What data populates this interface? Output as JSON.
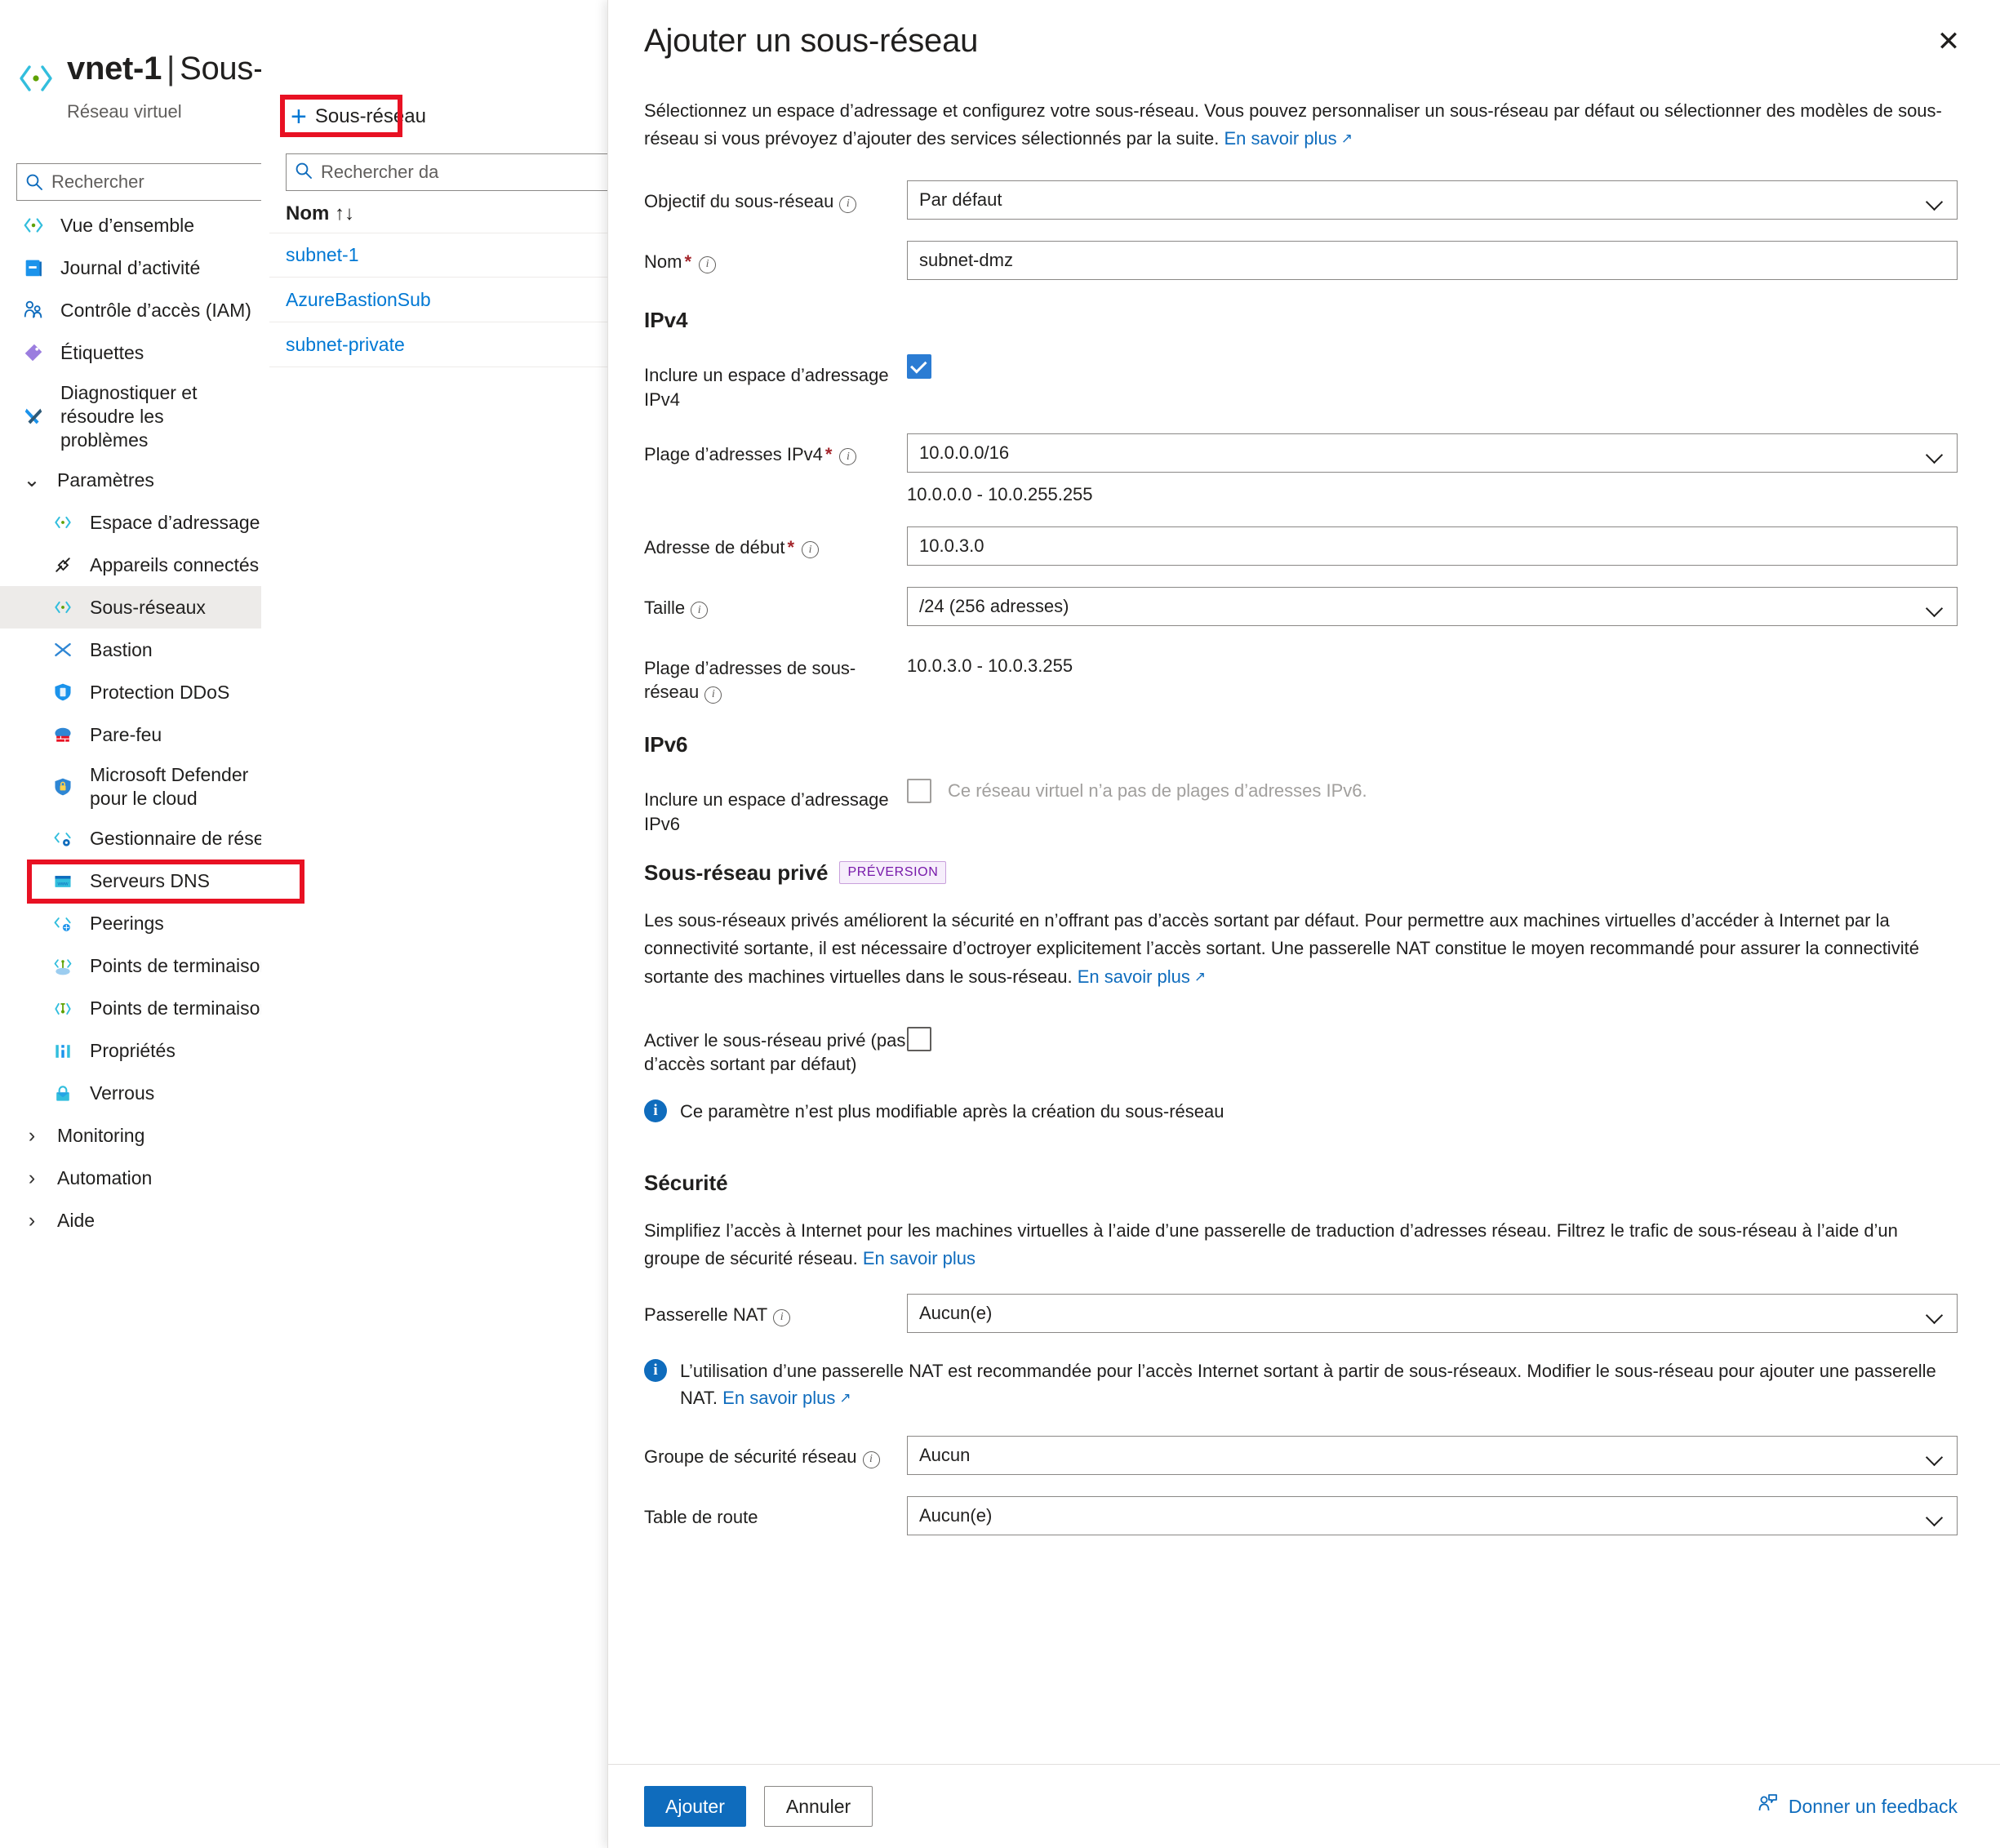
{
  "resource": {
    "icon": "virtual-network-icon",
    "name": "vnet-1",
    "separator": "|",
    "section": "Sous-réseaux",
    "type_label": "Réseau virtuel",
    "favorite_icon": "star-icon",
    "more_icon": "ellipsis-icon"
  },
  "nav": {
    "search_placeholder": "Rechercher",
    "sort_icon": "sort-icon",
    "collapse_icon": "collapse-icon",
    "items": [
      {
        "label": "Vue d’ensemble",
        "icon": "virtual-network-icon",
        "level": "top",
        "selected": false
      },
      {
        "label": "Journal d’activité",
        "icon": "activity-log-icon",
        "level": "top",
        "selected": false
      },
      {
        "label": "Contrôle d’accès (IAM)",
        "icon": "access-control-icon",
        "level": "top",
        "selected": false
      },
      {
        "label": "Étiquettes",
        "icon": "tag-icon",
        "level": "top",
        "selected": false
      },
      {
        "label": "Diagnostiquer et résoudre les problèmes",
        "icon": "troubleshoot-icon",
        "level": "top",
        "selected": false
      },
      {
        "label": "Paramètres",
        "icon": "chevron-down-icon",
        "level": "group",
        "selected": false
      },
      {
        "label": "Espace d’adressage",
        "icon": "address-space-icon",
        "level": "child",
        "selected": false
      },
      {
        "label": "Appareils connectés",
        "icon": "connected-devices-icon",
        "level": "child",
        "selected": false
      },
      {
        "label": "Sous-réseaux",
        "icon": "subnets-icon",
        "level": "child",
        "selected": true
      },
      {
        "label": "Bastion",
        "icon": "bastion-icon",
        "level": "child",
        "selected": false
      },
      {
        "label": "Protection DDoS",
        "icon": "ddos-protection-icon",
        "level": "child",
        "selected": false
      },
      {
        "label": "Pare-feu",
        "icon": "firewall-icon",
        "level": "child",
        "selected": false
      },
      {
        "label": "Microsoft Defender pour le cloud",
        "icon": "defender-icon",
        "level": "child",
        "selected": false
      },
      {
        "label": "Gestionnaire de réseau",
        "icon": "network-manager-icon",
        "level": "child",
        "selected": false
      },
      {
        "label": "Serveurs DNS",
        "icon": "dns-servers-icon",
        "level": "child",
        "selected": false
      },
      {
        "label": "Peerings",
        "icon": "peerings-icon",
        "level": "child",
        "selected": false
      },
      {
        "label": "Points de terminaison de service",
        "icon": "service-endpoints-icon",
        "level": "child",
        "selected": false
      },
      {
        "label": "Points de terminaison privés",
        "icon": "private-endpoints-icon",
        "level": "child",
        "selected": false
      },
      {
        "label": "Propriétés",
        "icon": "properties-icon",
        "level": "child",
        "selected": false
      },
      {
        "label": "Verrous",
        "icon": "locks-icon",
        "level": "child",
        "selected": false
      },
      {
        "label": "Monitoring",
        "icon": "chevron-right-icon",
        "level": "group",
        "selected": false
      },
      {
        "label": "Automation",
        "icon": "chevron-right-icon",
        "level": "group",
        "selected": false
      },
      {
        "label": "Aide",
        "icon": "chevron-right-icon",
        "level": "group",
        "selected": false
      }
    ]
  },
  "subnet_list": {
    "add_button": "Sous-réseau",
    "add_icon": "plus-icon",
    "search_placeholder": "Rechercher da",
    "column_name": "Nom",
    "sort_icon": "sort-arrows-icon",
    "rows": [
      "subnet-1",
      "AzureBastionSub",
      "subnet-private"
    ]
  },
  "panel": {
    "title": "Ajouter un sous-réseau",
    "close_icon": "close-icon",
    "description_part1": "Sélectionnez un espace d’adressage et configurez votre sous-réseau. Vous pouvez personnaliser un sous-réseau par défaut ou sélectionner des modèles de sous-réseau si vous prévoyez d’ajouter des services sélectionnés par la suite.",
    "description_link": "En savoir plus",
    "fields": {
      "purpose_label": "Objectif du sous-réseau",
      "purpose_value": "Par défaut",
      "name_label": "Nom",
      "name_value": "subnet-dmz",
      "ipv4_heading": "IPv4",
      "include_ipv4_label": "Inclure un espace d’adressage IPv4",
      "include_ipv4_checked": true,
      "ipv4_range_label": "Plage d’adresses IPv4",
      "ipv4_range_value": "10.0.0.0/16",
      "ipv4_range_hint": "10.0.0.0 - 10.0.255.255",
      "start_address_label": "Adresse de début",
      "start_address_value": "10.0.3.0",
      "size_label": "Taille",
      "size_value": "/24 (256 adresses)",
      "subnet_range_label": "Plage d’adresses de sous-réseau",
      "subnet_range_value": "10.0.3.0 - 10.0.3.255",
      "ipv6_heading": "IPv6",
      "include_ipv6_label": "Inclure un espace d’adressage IPv6",
      "include_ipv6_note": "Ce réseau virtuel n’a pas de plages d’adresses IPv6.",
      "private_subnet_heading": "Sous-réseau privé",
      "private_subnet_badge": "PRÉVERSION",
      "private_subnet_paragraph": "Les sous-réseaux privés améliorent la sécurité en n’offrant pas d’accès sortant par défaut. Pour permettre aux machines virtuelles d’accéder à Internet par la connectivité sortante, il est nécessaire d’octroyer explicitement l’accès sortant. Une passerelle NAT constitue le moyen recommandé pour assurer la connectivité sortante des machines virtuelles dans le sous-réseau.",
      "private_subnet_link": "En savoir plus",
      "enable_private_label": "Activer le sous-réseau privé (pas d’accès sortant par défaut)",
      "enable_private_checked": false,
      "private_info_note": "Ce paramètre n’est plus modifiable après la création du sous-réseau",
      "security_heading": "Sécurité",
      "security_paragraph": "Simplifiez l’accès à Internet pour les machines virtuelles à l’aide d’une passerelle de traduction d’adresses réseau. Filtrez le trafic de sous-réseau à l’aide d’un groupe de sécurité réseau.",
      "security_link": "En savoir plus",
      "nat_gateway_label": "Passerelle NAT",
      "nat_gateway_value": "Aucun(e)",
      "nat_info_note": "L’utilisation d’une passerelle NAT est recommandée pour l’accès Internet sortant à partir de sous-réseaux. Modifier le sous-réseau pour ajouter une passerelle NAT.",
      "nat_info_link": "En savoir plus",
      "nsg_label": "Groupe de sécurité réseau",
      "nsg_value": "Aucun",
      "route_table_label": "Table de route",
      "route_table_value": "Aucun(e)"
    },
    "footer": {
      "primary": "Ajouter",
      "secondary": "Annuler",
      "feedback": "Donner un feedback",
      "feedback_icon": "feedback-person-icon"
    }
  },
  "colors": {
    "accent": "#0f6cbd",
    "link": "#0078d4",
    "highlight": "#e81123",
    "badge_text": "#7719aa",
    "checkbox_on": "#2b7cd3"
  }
}
